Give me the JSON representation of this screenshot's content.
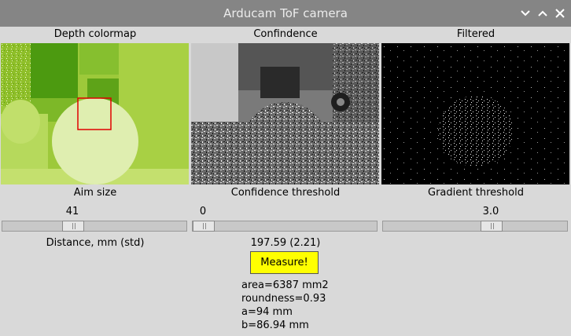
{
  "window": {
    "title": "Arducam ToF camera"
  },
  "columns": {
    "depth_title": "Depth colormap",
    "confidence_title": "Confindence",
    "filtered_title": "Filtered"
  },
  "controls": {
    "aim_size": {
      "label": "Aim size",
      "value": "41",
      "fraction": 0.37
    },
    "confidence_threshold": {
      "label": "Confidence threshold",
      "value": "0",
      "fraction": 0.0
    },
    "gradient_threshold": {
      "label": "Gradient threshold",
      "value": "3.0",
      "fraction": 0.6
    }
  },
  "distance": {
    "label": "Distance, mm (std)",
    "value": "197.59 (2.21)"
  },
  "measure_button": {
    "label": "Measure!"
  },
  "results": {
    "area": "area=6387 mm2",
    "roundness": "roundness=0.93",
    "a": "a=94 mm",
    "b": "b=86.94 mm"
  },
  "colors": {
    "measure_bg": "#ffff00",
    "aim_box": "#e00000"
  }
}
